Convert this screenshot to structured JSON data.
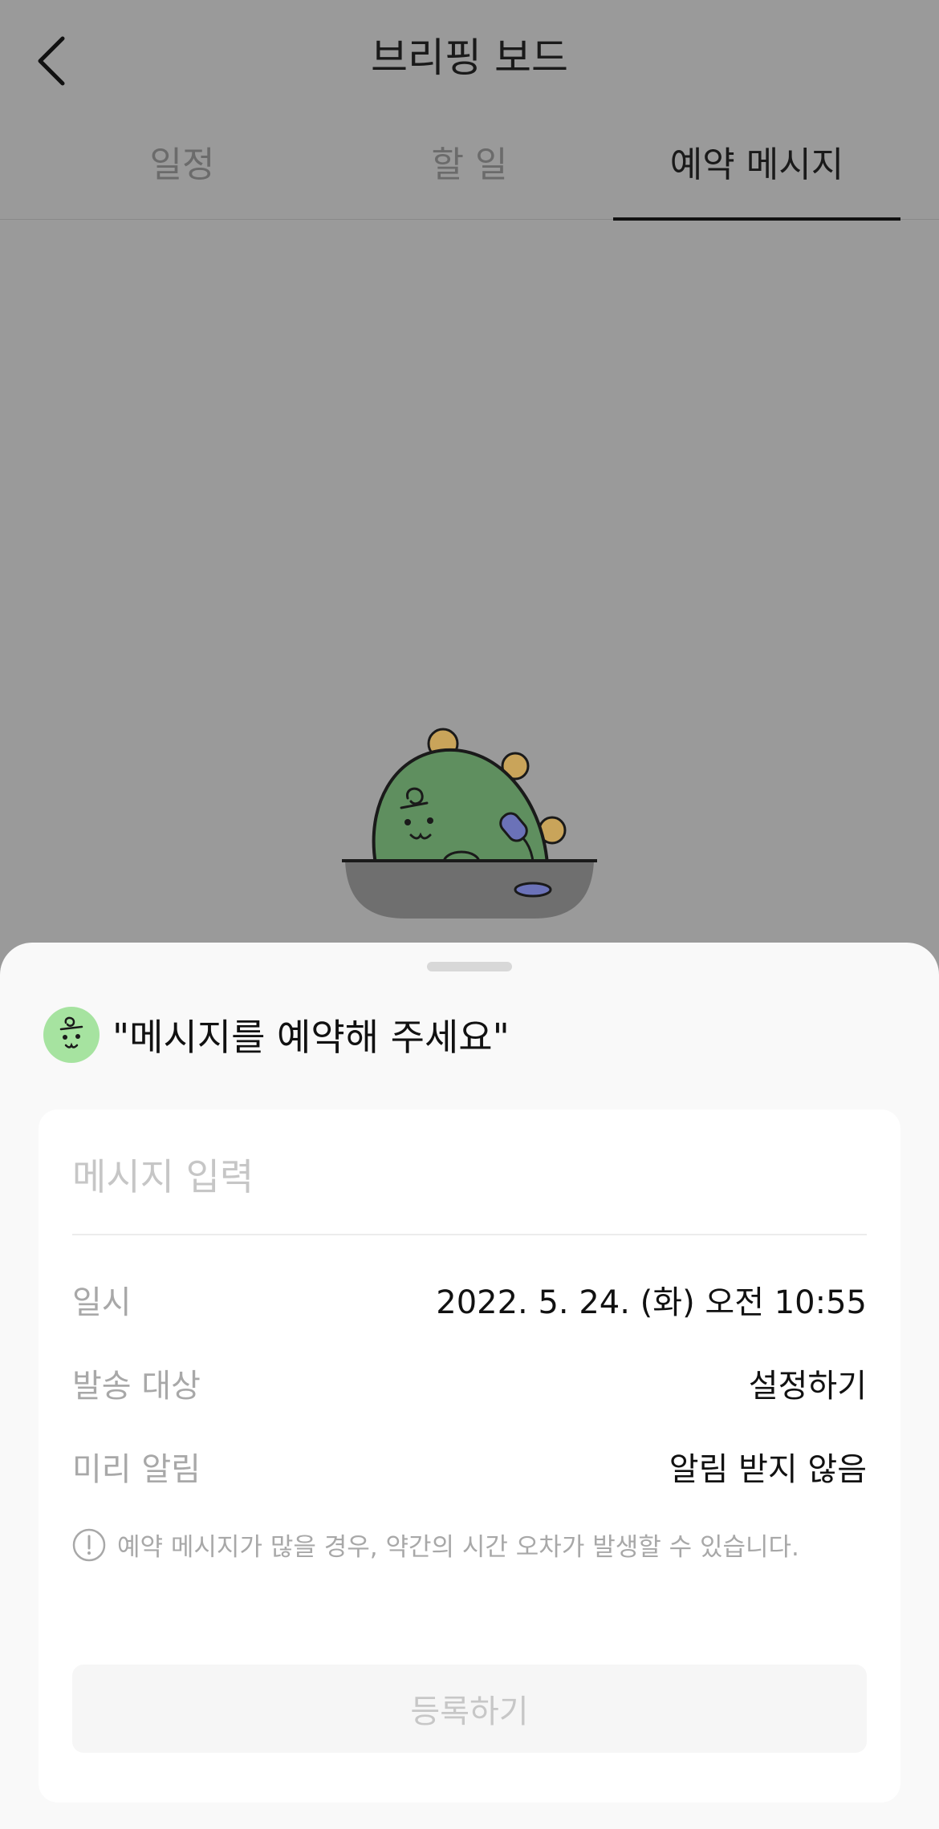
{
  "header": {
    "title": "브리핑 보드",
    "back_icon": "chevron-left-icon"
  },
  "tabs": [
    {
      "label": "일정",
      "active": false
    },
    {
      "label": "할 일",
      "active": false
    },
    {
      "label": "예약 메시지",
      "active": true
    }
  ],
  "sheet": {
    "prompt": "\"메시지를 예약해 주세요\"",
    "avatar_icon": "mascot-avatar-icon",
    "message_input": {
      "placeholder": "메시지 입력",
      "value": ""
    },
    "fields": [
      {
        "label": "일시",
        "value": "2022. 5. 24. (화) 오전 10:55"
      },
      {
        "label": "발송 대상",
        "value": "설정하기"
      },
      {
        "label": "미리 알림",
        "value": "알림 받지 않음"
      }
    ],
    "notice": "예약 메시지가 많을 경우, 약간의 시간 오차가 발생할 수 있습니다.",
    "submit_label": "등록하기"
  },
  "colors": {
    "overlay": "#9a9a9a",
    "sheet_bg": "#f9f9f9",
    "card_bg": "#ffffff",
    "avatar_bg": "#a6e3a0",
    "muted_text": "#a8a8a8",
    "active_tab_underline": "#111111"
  }
}
